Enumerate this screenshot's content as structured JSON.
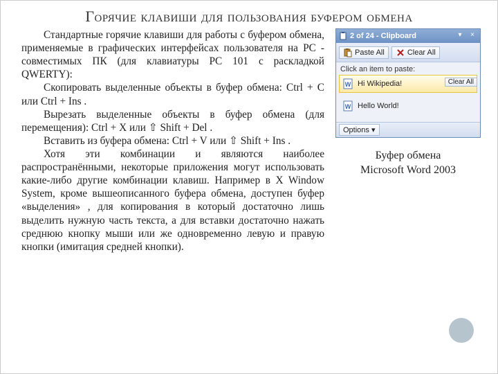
{
  "title": "Горячие клавиши для пользования буфером обмена",
  "p1": "Стандартные горячие клавиши для работы с буфером обмена, применяемые в графических интерфейсах пользователя на PC - совместимых ПК (для клавиатуры PC 101 с раскладкой QWERTY):",
  "p2": "Скопировать выделенные объекты в буфер обмена:  Ctrl  +  C  или  Ctrl  +  Ins .",
  "p3": "Вырезать выделенные объекты в буфер обмена (для перемещения):   Ctrl  +  X  или  ⇧ Shift  +  Del .",
  "p4": "Вставить из буфера обмена:  Ctrl  +  V  или  ⇧ Shift  +  Ins .",
  "p5": "Хотя эти комбинации и являются наиболее распространёнными, некоторые приложения могут использовать какие-либо другие комбинации клавиш. Например в X Window System, кроме вышеописанного буфера обмена, доступен буфер «выделения» , для копирования в который достаточно лишь выделить нужную часть текста, а для вставки достаточно нажать среднюю кнопку мыши или же одновременно левую и правую кнопки (имитация средней кнопки).",
  "clipboard": {
    "header": {
      "counter": "2 of 24 - Clipboard",
      "min": "▾",
      "close": "×"
    },
    "toolbar": {
      "paste_all": "Paste All",
      "clear_all": "Clear All"
    },
    "hint": "Click an item to paste:",
    "items": [
      {
        "text": "Hi Wikipedia!",
        "selected": true
      },
      {
        "text": "Hello World!",
        "selected": false
      }
    ],
    "mini_clear": "Clear All",
    "options": "Options ▾"
  },
  "caption_l1": "Буфер обмена",
  "caption_l2": "Microsoft Word 2003"
}
